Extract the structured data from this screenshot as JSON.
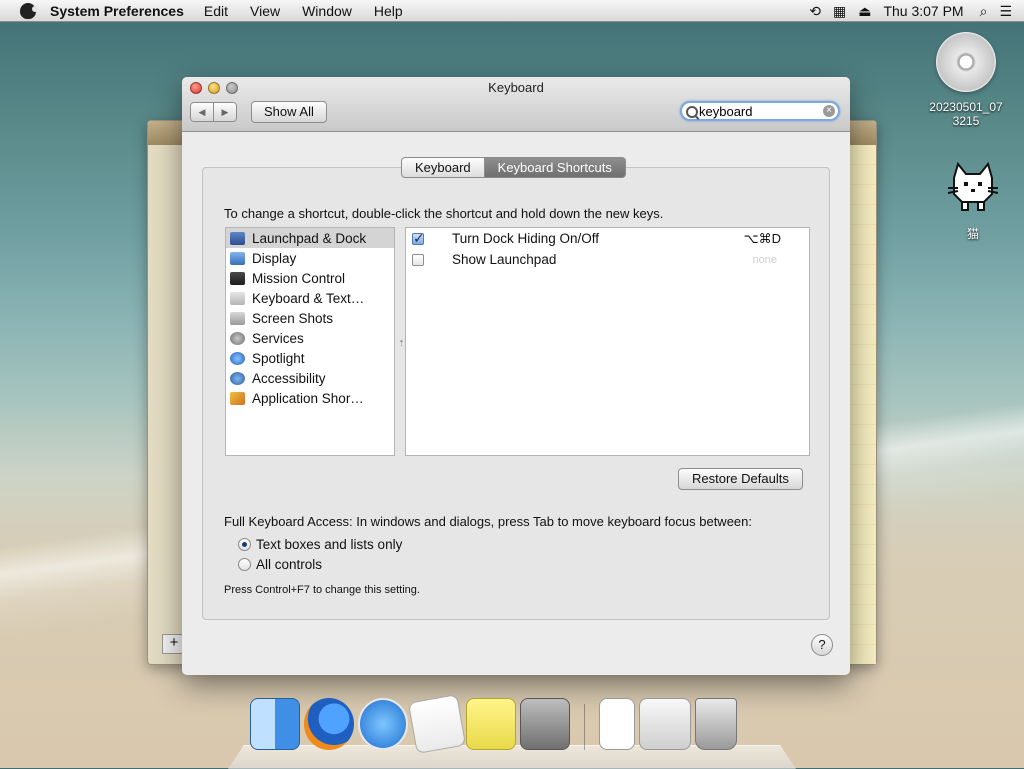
{
  "menubar": {
    "app_name": "System Preferences",
    "menus": [
      "Edit",
      "View",
      "Window",
      "Help"
    ],
    "clock": "Thu 3:07 PM"
  },
  "window": {
    "title": "Keyboard",
    "show_all": "Show All",
    "search": {
      "value": "keyboard"
    }
  },
  "tabs": {
    "keyboard": "Keyboard",
    "shortcuts": "Keyboard Shortcuts"
  },
  "content": {
    "instructions": "To change a shortcut, double-click the shortcut and hold down the new keys.",
    "categories": [
      "Launchpad & Dock",
      "Display",
      "Mission Control",
      "Keyboard & Text…",
      "Screen Shots",
      "Services",
      "Spotlight",
      "Accessibility",
      "Application Shor…"
    ],
    "shortcuts": [
      {
        "label": "Turn Dock Hiding On/Off",
        "key": "⌥⌘D",
        "checked": true
      },
      {
        "label": "Show Launchpad",
        "key": "none",
        "checked": false
      }
    ],
    "restore_defaults": "Restore Defaults",
    "full_keyboard_access": "Full Keyboard Access: In windows and dialogs, press Tab to move keyboard focus between:",
    "radio_options": [
      "Text boxes and lists only",
      "All controls"
    ],
    "hint": "Press Control+F7 to change this setting.",
    "help": "?"
  },
  "desktop": {
    "dvd_label_line1": "20230501_07",
    "dvd_label_line2": "3215",
    "cat_label": "猫"
  },
  "colors": {
    "accent": "#7ea9e0",
    "tab_active": "#7a7a7a"
  }
}
